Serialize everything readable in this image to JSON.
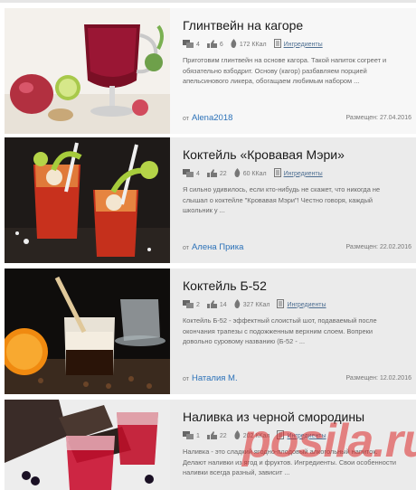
{
  "recipes": [
    {
      "title": "Глинтвейн на кагоре",
      "comments": "4",
      "likes": "6",
      "calories": "172 ККал",
      "ingredients_label": "Ингредиенты",
      "description": "Приготовим глинтвейн на основе кагора. Такой напиток согреет и обязательно взбодрит. Основу (кагор) разбавляем порцией апельсинового ликера, обогащаем любимым набором ...",
      "author_prefix": "от",
      "author": "Alena2018",
      "posted_label": "Размещен:",
      "date": "27.04.2016"
    },
    {
      "title": "Коктейль «Кровавая Мэри»",
      "comments": "4",
      "likes": "22",
      "calories": "60 ККал",
      "ingredients_label": "Ингредиенты",
      "description": "Я сильно удивилось, если кто-нибудь не скажет, что никогда не слышал о коктейле \"Кровавая Мэри\"! Честно говоря, каждый школьник у ...",
      "author_prefix": "от",
      "author": "Алена Прика",
      "posted_label": "Размещен:",
      "date": "22.02.2016"
    },
    {
      "title": "Коктейль Б-52",
      "comments": "2",
      "likes": "14",
      "calories": "327 ККал",
      "ingredients_label": "Ингредиенты",
      "description": "Коктейль Б-52 - эффектный слоистый шот, подаваемый после окончания трапезы с подожженным верхним слоем. Вопреки довольно суровому названию (Б-52 - ...",
      "author_prefix": "от",
      "author": "Наталия М.",
      "posted_label": "Размещен:",
      "date": "12.02.2016"
    },
    {
      "title": "Наливка из черной смородины",
      "comments": "1",
      "likes": "22",
      "calories": "202 ККал",
      "ingredients_label": "Ингредиенты",
      "description": "Наливка - это сладкий ягодно-плодовый алкогольный напиток. Делают наливки из ягод и фруктов. Ингредиенты. Свои особенности наливки всегда разный, зависит ...",
      "author_prefix": "",
      "author": "",
      "posted_label": "",
      "date": ""
    }
  ],
  "watermark": "posila.ru",
  "colors": {
    "link": "#2b71b8",
    "watermark": "#dc2828"
  }
}
